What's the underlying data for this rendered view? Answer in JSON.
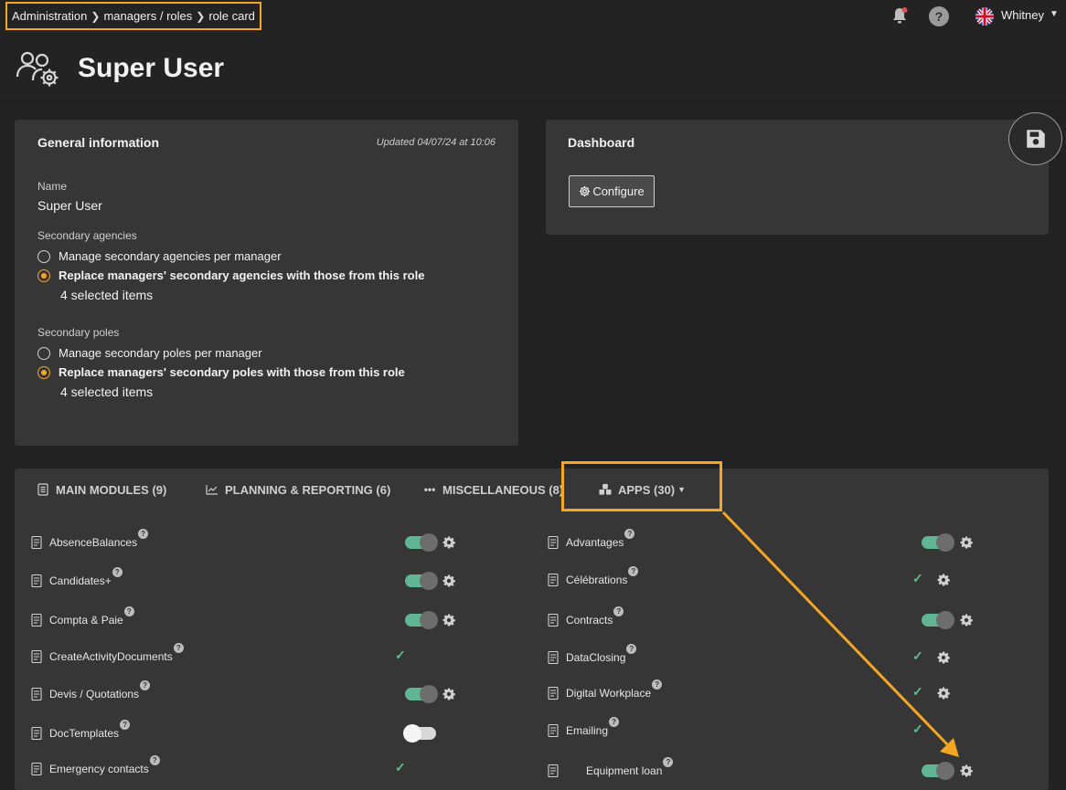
{
  "breadcrumb": {
    "items": [
      "Administration",
      "managers / roles",
      "role card"
    ]
  },
  "user": {
    "name": "Whitney"
  },
  "page": {
    "title": "Super User"
  },
  "general": {
    "title": "General information",
    "updated": "Updated 04/07/24 at 10:06",
    "name_label": "Name",
    "name_value": "Super User",
    "agencies_label": "Secondary agencies",
    "agencies_opt1": "Manage secondary agencies per manager",
    "agencies_opt2": "Replace managers' secondary agencies with those from this role",
    "agencies_count": "4 selected items",
    "poles_label": "Secondary poles",
    "poles_opt1": "Manage secondary poles per manager",
    "poles_opt2": "Replace managers' secondary poles with those from this role",
    "poles_count": "4 selected items"
  },
  "dashboard": {
    "title": "Dashboard",
    "configure": "Configure"
  },
  "tabs": {
    "main": "MAIN MODULES (9)",
    "planning": "PLANNING & REPORTING (6)",
    "misc": "MISCELLANEOUS (8)",
    "apps": "APPS (30)"
  },
  "apps": {
    "left": [
      {
        "name": "AbsenceBalances",
        "icon": "beach-icon",
        "state": "on",
        "gear": true
      },
      {
        "name": "Candidates+",
        "icon": "graduation-cap-icon",
        "state": "on",
        "gear": true
      },
      {
        "name": "Compta & Paie",
        "icon": "document-euro-icon",
        "state": "on",
        "gear": true
      },
      {
        "name": "CreateActivityDocuments",
        "icon": "documents-icon",
        "state": "check",
        "gear": false
      },
      {
        "name": "Devis / Quotations",
        "icon": "quote-document-icon",
        "state": "on",
        "gear": true
      },
      {
        "name": "DocTemplates",
        "icon": "template-icon",
        "state": "off",
        "gear": false
      },
      {
        "name": "Emergency contacts",
        "icon": "emergency-contact-icon",
        "state": "check",
        "gear": false
      }
    ],
    "right": [
      {
        "name": "Advantages",
        "icon": "hand-coins-icon",
        "state": "on",
        "gear": true
      },
      {
        "name": "Célébrations",
        "icon": "party-icon",
        "state": "check",
        "gear": true
      },
      {
        "name": "Contracts",
        "icon": "contract-icon",
        "state": "on",
        "gear": true
      },
      {
        "name": "DataClosing",
        "icon": "lock-document-icon",
        "state": "check",
        "gear": true
      },
      {
        "name": "Digital Workplace",
        "icon": "workplace-icon",
        "state": "check",
        "gear": true
      },
      {
        "name": "Emailing",
        "icon": "email-icon",
        "state": "check",
        "gear": false
      },
      {
        "name": "Equipment loan",
        "icon": "computer-icon",
        "state": "on",
        "gear": true
      }
    ]
  },
  "colors": {
    "accent": "#f5a623",
    "toggle_on": "#5fb596",
    "check": "#5fbf91"
  }
}
